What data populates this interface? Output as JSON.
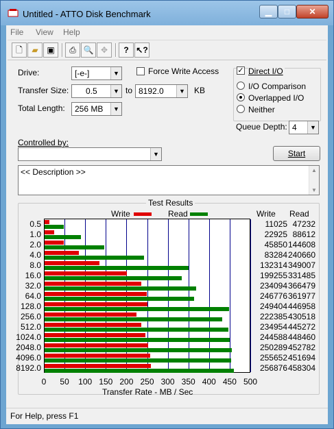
{
  "window": {
    "title": "Untitled - ATTO Disk Benchmark"
  },
  "menu": [
    "File",
    "View",
    "Help"
  ],
  "toolbar": [
    "new-icon",
    "open-icon",
    "save-icon",
    "print-icon",
    "print-preview-icon",
    "move-icon",
    "help-icon",
    "context-help-icon"
  ],
  "settings": {
    "drive_label": "Drive:",
    "drive_value": "[-e-]",
    "force_write_label": "Force Write Access",
    "force_write_checked": false,
    "direct_io_label": "Direct I/O",
    "direct_io_checked": true,
    "transfer_size_label": "Transfer Size:",
    "transfer_from": "0.5",
    "to_label": "to",
    "transfer_to": "8192.0",
    "kb_label": "KB",
    "total_length_label": "Total Length:",
    "total_length_value": "256 MB",
    "io_comparison_label": "I/O Comparison",
    "overlapped_io_label": "Overlapped I/O",
    "neither_label": "Neither",
    "selected_mode": "Overlapped I/O",
    "queue_depth_label": "Queue Depth:",
    "queue_depth_value": "4",
    "controlled_by_label": "Controlled by:",
    "controlled_by_value": "",
    "start_label": "Start",
    "description": "<< Description >>"
  },
  "results": {
    "group_title": "Test Results",
    "legend_write": "Write",
    "legend_read": "Read",
    "col_write": "Write",
    "col_read": "Read",
    "xlabel": "Transfer Rate - MB / Sec",
    "colors": {
      "write": "#e00000",
      "read": "#008000",
      "grid": "#00008b"
    }
  },
  "chart_data": {
    "type": "bar",
    "orientation": "horizontal",
    "categories": [
      "0.5",
      "1.0",
      "2.0",
      "4.0",
      "8.0",
      "16.0",
      "32.0",
      "64.0",
      "128.0",
      "256.0",
      "512.0",
      "1024.0",
      "2048.0",
      "4096.0",
      "8192.0"
    ],
    "series": [
      {
        "name": "Write",
        "values": [
          11025,
          22925,
          45850,
          83284,
          132314,
          199255,
          234094,
          246776,
          249404,
          222385,
          234954,
          244588,
          250289,
          255652,
          256876
        ]
      },
      {
        "name": "Read",
        "values": [
          47232,
          88612,
          144608,
          240660,
          349007,
          331485,
          366479,
          361977,
          446958,
          430518,
          445272,
          448460,
          452782,
          451694,
          458304
        ]
      }
    ],
    "xlabel": "Transfer Rate - MB / Sec",
    "xlim": [
      0,
      500
    ],
    "xticks": [
      "0",
      "50",
      "100",
      "150",
      "200",
      "250",
      "300",
      "350",
      "400",
      "450",
      "500"
    ],
    "grid": true,
    "legend": "top"
  },
  "status": {
    "text": "For Help, press F1"
  }
}
